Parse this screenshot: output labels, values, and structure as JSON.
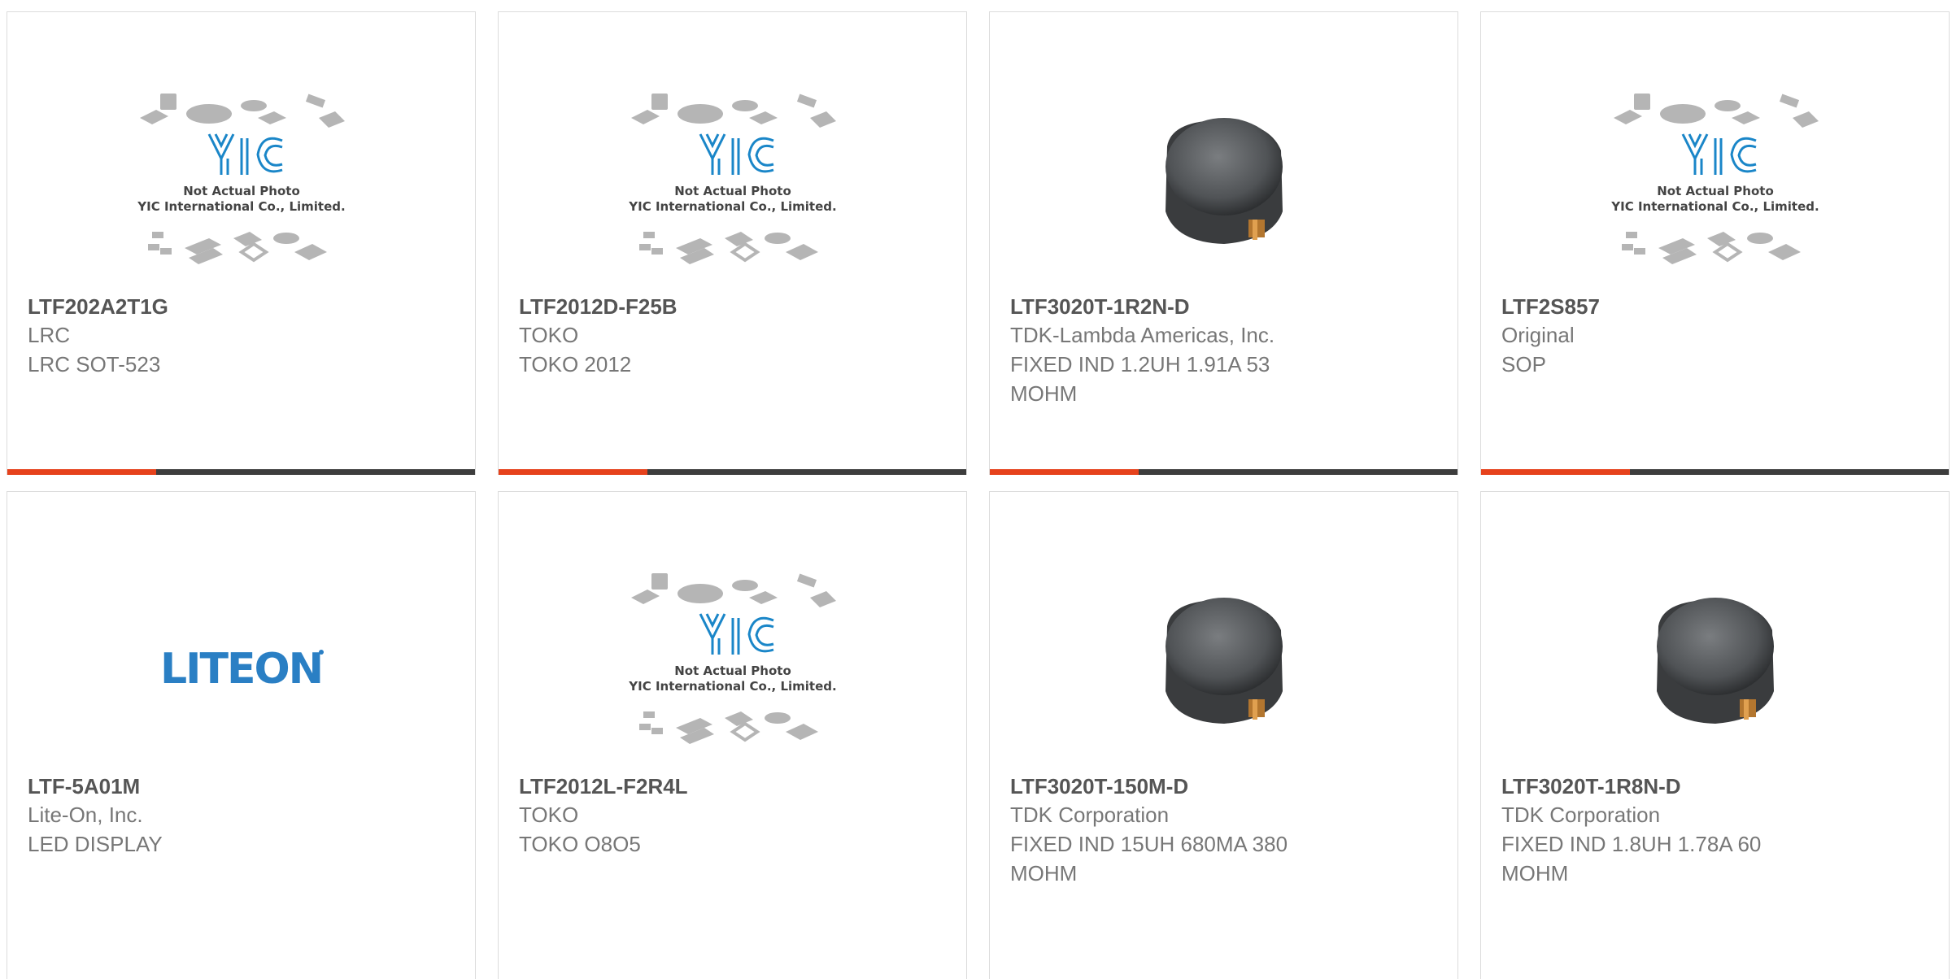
{
  "cards": [
    {
      "part": "LTF202A2T1G",
      "manufacturer": "LRC",
      "description": "LRC SOT-523",
      "image": "placeholder",
      "placeholder_line1": "Not Actual Photo",
      "placeholder_line2": "YIC International Co., Limited."
    },
    {
      "part": "LTF2012D-F25B",
      "manufacturer": "TOKO",
      "description": "TOKO 2012",
      "image": "placeholder",
      "placeholder_line1": "Not Actual Photo",
      "placeholder_line2": "YIC International Co., Limited."
    },
    {
      "part": "LTF3020T-1R2N-D",
      "manufacturer": "TDK-Lambda Americas, Inc.",
      "description": "FIXED IND 1.2UH 1.91A 53 MOHM",
      "image": "inductor"
    },
    {
      "part": "LTF2S857",
      "manufacturer": "Original",
      "description": "SOP",
      "image": "placeholder",
      "placeholder_line1": "Not Actual Photo",
      "placeholder_line2": "YIC International Co., Limited."
    },
    {
      "part": "LTF-5A01M",
      "manufacturer": "Lite-On, Inc.",
      "description": "LED DISPLAY",
      "image": "liteon",
      "logo_text": "LITEON"
    },
    {
      "part": "LTF2012L-F2R4L",
      "manufacturer": "TOKO",
      "description": "TOKO O8O5",
      "image": "placeholder",
      "placeholder_line1": "Not Actual Photo",
      "placeholder_line2": "YIC International Co., Limited."
    },
    {
      "part": "LTF3020T-150M-D",
      "manufacturer": "TDK Corporation",
      "description": "FIXED IND 15UH 680MA 380 MOHM",
      "image": "inductor"
    },
    {
      "part": "LTF3020T-1R8N-D",
      "manufacturer": "TDK Corporation",
      "description": "FIXED IND 1.8UH 1.78A 60 MOHM",
      "image": "inductor"
    }
  ],
  "colors": {
    "accent": "#e6421c",
    "bar": "#3d3d3d",
    "brand_blue": "#1a86c8",
    "logo_blue": "#2a7fc4"
  }
}
